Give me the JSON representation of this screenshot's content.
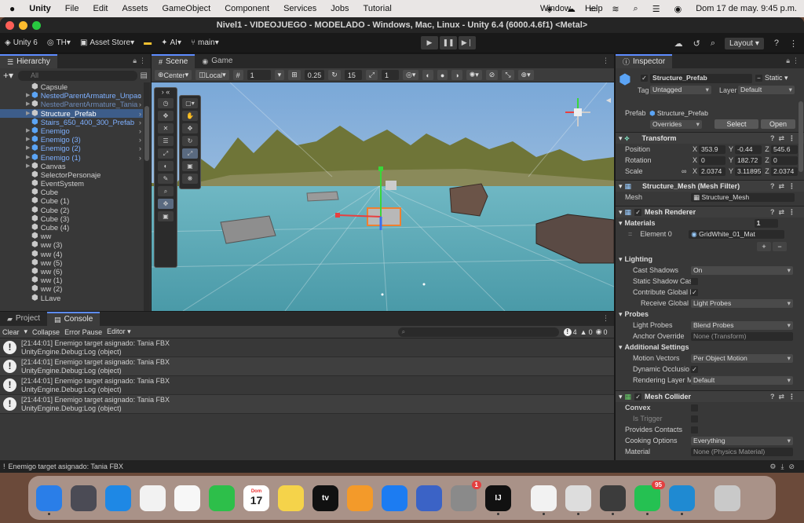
{
  "menubar": {
    "app": "Unity",
    "items": [
      "File",
      "Edit",
      "Assets",
      "GameObject",
      "Component",
      "Services",
      "Jobs",
      "Tutorial"
    ],
    "window": "Window",
    "help": "Help",
    "clock": "Dom 17 de may.  9:45 p.m."
  },
  "window": {
    "title": "Nivel1 - VIDEOJUEGO - MODELADO - Windows, Mac, Linux - Unity 6.4 (6000.4.6f1) <Metal>"
  },
  "toolbar": {
    "unity": "Unity 6",
    "account": "TH",
    "asset_store": "Asset Store",
    "ai": "AI",
    "branch": "main",
    "layout": "Layout"
  },
  "hierarchy": {
    "tab": "Hierarchy",
    "search_placeholder": "All",
    "items": [
      {
        "label": "Capsule",
        "style": "",
        "arrow": ""
      },
      {
        "label": "NestedParentArmature_Unpac",
        "style": "blue",
        "arrow": "▶"
      },
      {
        "label": "NestedParentArmature_Tania",
        "style": "dim",
        "arrow": "▶"
      },
      {
        "label": "Structure_Prefab",
        "style": "sel",
        "arrow": "▶"
      },
      {
        "label": "Stairs_650_400_300_Prefab",
        "style": "blue",
        "arrow": ""
      },
      {
        "label": "Enemigo",
        "style": "blue",
        "arrow": "▶"
      },
      {
        "label": "Enemigo (3)",
        "style": "blue",
        "arrow": "▶"
      },
      {
        "label": "Enemigo (2)",
        "style": "blue",
        "arrow": "▶"
      },
      {
        "label": "Enemigo (1)",
        "style": "blue",
        "arrow": "▶"
      },
      {
        "label": "Canvas",
        "style": "",
        "arrow": "▶"
      },
      {
        "label": "SelectorPersonaje",
        "style": "",
        "arrow": ""
      },
      {
        "label": "EventSystem",
        "style": "",
        "arrow": ""
      },
      {
        "label": "Cube",
        "style": "",
        "arrow": ""
      },
      {
        "label": "Cube (1)",
        "style": "",
        "arrow": ""
      },
      {
        "label": "Cube (2)",
        "style": "",
        "arrow": ""
      },
      {
        "label": "Cube (3)",
        "style": "",
        "arrow": ""
      },
      {
        "label": "Cube (4)",
        "style": "",
        "arrow": ""
      },
      {
        "label": "ww",
        "style": "",
        "arrow": ""
      },
      {
        "label": "ww (3)",
        "style": "",
        "arrow": ""
      },
      {
        "label": "ww (4)",
        "style": "",
        "arrow": ""
      },
      {
        "label": "ww (5)",
        "style": "",
        "arrow": ""
      },
      {
        "label": "ww (6)",
        "style": "",
        "arrow": ""
      },
      {
        "label": "ww (1)",
        "style": "",
        "arrow": ""
      },
      {
        "label": "ww (2)",
        "style": "",
        "arrow": ""
      },
      {
        "label": "LLave",
        "style": "",
        "arrow": ""
      }
    ]
  },
  "scene": {
    "tab_scene": "Scene",
    "tab_game": "Game",
    "pivot": "Center",
    "space": "Local",
    "grid_value": "1",
    "snap_rotate": "0.25",
    "snap_angle": "15",
    "snap_scale": "1"
  },
  "console": {
    "tab_project": "Project",
    "tab_console": "Console",
    "clear": "Clear",
    "collapse": "Collapse",
    "error_pause": "Error Pause",
    "editor": "Editor",
    "count_warn": "4",
    "count_err": "0",
    "count_info": "0",
    "entries": [
      {
        "line1": "[21:44:01] Enemigo target asignado: Tania FBX",
        "line2": "UnityEngine.Debug:Log (object)"
      },
      {
        "line1": "[21:44:01] Enemigo target asignado: Tania FBX",
        "line2": "UnityEngine.Debug:Log (object)"
      },
      {
        "line1": "[21:44:01] Enemigo target asignado: Tania FBX",
        "line2": "UnityEngine.Debug:Log (object)"
      },
      {
        "line1": "[21:44:01] Enemigo target asignado: Tania FBX",
        "line2": "UnityEngine.Debug:Log (object)"
      }
    ],
    "status": "Enemigo target asignado: Tania FBX"
  },
  "inspector": {
    "tab": "Inspector",
    "name": "Structure_Prefab",
    "static": "Static",
    "tag_label": "Tag",
    "tag": "Untagged",
    "layer_label": "Layer",
    "layer": "Default",
    "prefab_label": "Prefab",
    "prefab": "Structure_Prefab",
    "overrides": "Overrides",
    "select": "Select",
    "open": "Open",
    "transform": {
      "title": "Transform",
      "position_label": "Position",
      "rotation_label": "Rotation",
      "scale_label": "Scale",
      "position": {
        "x": "353.9",
        "y": "-0.44",
        "z": "545.6"
      },
      "rotation": {
        "x": "0",
        "y": "182.72",
        "z": "0"
      },
      "scale": {
        "x": "2.0374",
        "y": "3.11895",
        "z": "2.0374"
      }
    },
    "mesh_filter": {
      "title": "Structure_Mesh (Mesh Filter)",
      "mesh_label": "Mesh",
      "mesh": "Structure_Mesh"
    },
    "mesh_renderer": {
      "title": "Mesh Renderer",
      "materials_label": "Materials",
      "materials_count": "1",
      "element_label": "Element 0",
      "element": "GridWhite_01_Mat",
      "lighting": "Lighting",
      "cast_shadows_label": "Cast Shadows",
      "cast_shadows": "On",
      "static_shadow_label": "Static Shadow Cas",
      "contribute_gi_label": "Contribute Global I",
      "receive_gi_label": "Receive Global I",
      "receive_gi": "Light Probes",
      "probes": "Probes",
      "light_probes_label": "Light Probes",
      "light_probes": "Blend Probes",
      "anchor_label": "Anchor Override",
      "anchor": "None (Transform)",
      "additional": "Additional Settings",
      "motion_label": "Motion Vectors",
      "motion": "Per Object Motion",
      "dyn_occ_label": "Dynamic Occlusio",
      "render_layer_label": "Rendering Layer M",
      "render_layer": "Default"
    },
    "mesh_collider": {
      "title": "Mesh Collider",
      "convex_label": "Convex",
      "trigger_label": "Is Trigger",
      "contacts_label": "Provides Contacts",
      "cooking_label": "Cooking Options",
      "cooking": "Everything",
      "material_label": "Material",
      "material": "None (Physics Material)"
    }
  },
  "dock": {
    "apps": [
      {
        "name": "finder",
        "label": "",
        "color": "#2a7ee8"
      },
      {
        "name": "launchpad",
        "label": "",
        "color": "#4b4b55"
      },
      {
        "name": "safari",
        "label": "",
        "color": "#1e88e5"
      },
      {
        "name": "reminders",
        "label": "",
        "color": "#f2f2f2"
      },
      {
        "name": "photos",
        "label": "",
        "color": "#f7f7f7"
      },
      {
        "name": "facetime",
        "label": "",
        "color": "#2dbf4a"
      },
      {
        "name": "calendar",
        "label": "17",
        "color": "#ffffff"
      },
      {
        "name": "notes",
        "label": "",
        "color": "#f5d34a"
      },
      {
        "name": "tv",
        "label": "tv",
        "color": "#111111"
      },
      {
        "name": "pages",
        "label": "",
        "color": "#f39a2a"
      },
      {
        "name": "appstore",
        "label": "",
        "color": "#1c7cf2"
      },
      {
        "name": "simulator",
        "label": "",
        "color": "#3b63c6"
      },
      {
        "name": "settings",
        "label": "",
        "color": "#8a8a8a"
      },
      {
        "name": "intellij",
        "label": "IJ",
        "color": "#111111"
      },
      {
        "name": "chrome",
        "label": "",
        "color": "#f2f2f2"
      },
      {
        "name": "unity-hub",
        "label": "",
        "color": "#dddddd"
      },
      {
        "name": "unity",
        "label": "",
        "color": "#3c3c3c"
      },
      {
        "name": "whatsapp",
        "label": "",
        "color": "#25c152"
      },
      {
        "name": "vscode",
        "label": "",
        "color": "#1f8ad2"
      },
      {
        "name": "trash",
        "label": "",
        "color": "#c9c9c9"
      }
    ],
    "calendar_month": "Dom",
    "settings_badge": "1",
    "whatsapp_badge": "95"
  },
  "colors": {
    "accent": "#5d8cff",
    "selection": "#3d5d8a",
    "prefab_blue": "#7eb0ff"
  }
}
